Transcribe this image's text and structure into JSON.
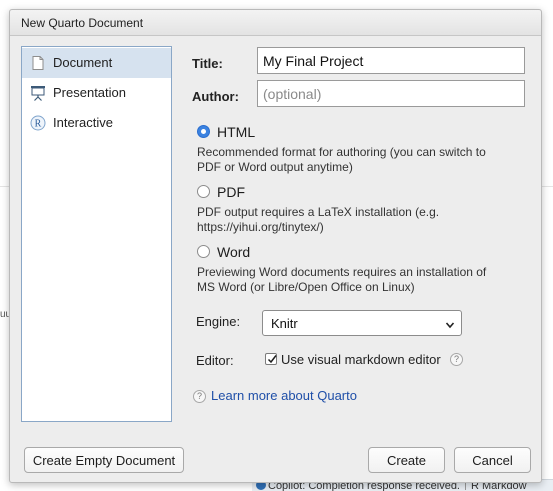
{
  "background": {
    "fragment": "uu",
    "status": {
      "message": "Copilot: Completion response received.",
      "next": "R Markdow"
    }
  },
  "dialog": {
    "title": "New Quarto Document",
    "types": [
      {
        "label": "Document",
        "icon": "document-icon",
        "selected": true
      },
      {
        "label": "Presentation",
        "icon": "presentation-icon",
        "selected": false
      },
      {
        "label": "Interactive",
        "icon": "r-interactive-icon",
        "selected": false
      }
    ],
    "form": {
      "title_label": "Title:",
      "title_value": "My Final Project",
      "author_label": "Author:",
      "author_placeholder": "(optional)",
      "formats": [
        {
          "label": "HTML",
          "checked": true,
          "desc1": "Recommended format for authoring (you can switch to",
          "desc2": "PDF or Word output anytime)"
        },
        {
          "label": "PDF",
          "checked": false,
          "desc1": "PDF output requires a LaTeX installation (e.g.",
          "desc2": "https://yihui.org/tinytex/)"
        },
        {
          "label": "Word",
          "checked": false,
          "desc1": "Previewing Word documents requires an installation of",
          "desc2": "MS Word (or Libre/Open Office on Linux)"
        }
      ],
      "engine_label": "Engine:",
      "engine_value": "Knitr",
      "editor_label": "Editor:",
      "visual_editor_label": "Use visual markdown editor",
      "visual_editor_checked": true,
      "help_glyph": "?",
      "learn_more": "Learn more about Quarto"
    },
    "buttons": {
      "empty": "Create Empty Document",
      "create": "Create",
      "cancel": "Cancel"
    }
  },
  "colors": {
    "accent": "#3b82e0",
    "selection": "#d6e2ef",
    "link": "#1f4fa8"
  }
}
